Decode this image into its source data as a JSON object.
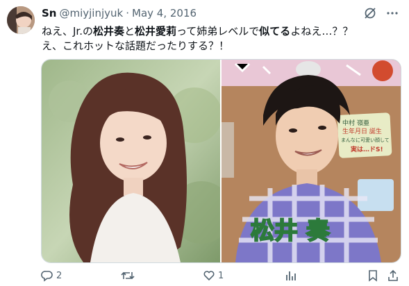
{
  "tweet": {
    "author_name": "Sn",
    "handle": "@miyjinjyuk",
    "separator": "·",
    "date": "May 4, 2016",
    "line1": [
      {
        "t": "ねえ、Jr.の",
        "b": false
      },
      {
        "t": "松井奏",
        "b": true
      },
      {
        "t": "と",
        "b": false
      },
      {
        "t": "松井愛莉",
        "b": true
      },
      {
        "t": "って姉弟レベルで",
        "b": false
      },
      {
        "t": "似てる",
        "b": true
      },
      {
        "t": "よねえ…？？",
        "b": false
      }
    ],
    "line2": "え、これホットな話題だったりする？！"
  },
  "media": {
    "right_caption": "松井 奏",
    "sign_lines": [
      "中村 嶺亜",
      "生年月日 誕生",
      "まんなに可愛い顔して",
      "実は…ドS!"
    ]
  },
  "actions": {
    "reply_count": "2",
    "retweet_count": "",
    "like_count": "1"
  },
  "icons": [
    "grok-icon",
    "more-icon",
    "reply-icon",
    "retweet-icon",
    "like-icon",
    "views-icon",
    "bookmark-icon",
    "share-icon"
  ]
}
